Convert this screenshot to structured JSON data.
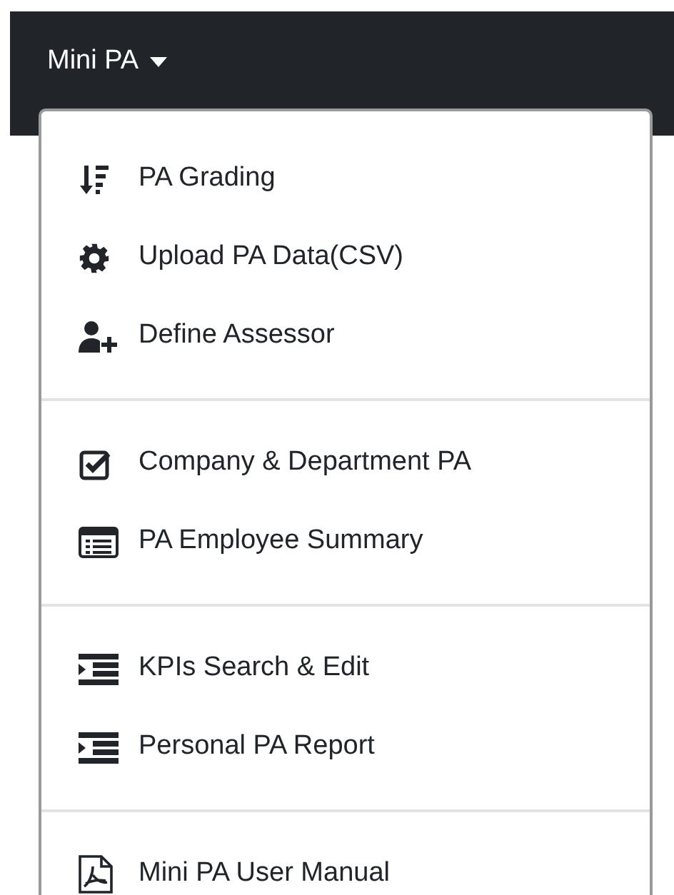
{
  "navbar": {
    "menu_title": "Mini PA"
  },
  "dropdown": {
    "groups": [
      {
        "items": [
          {
            "label": "PA Grading",
            "kind": "sort"
          },
          {
            "label": "Upload PA Data(CSV)",
            "kind": "gear"
          },
          {
            "label": "Define Assessor",
            "kind": "user-plus"
          }
        ]
      },
      {
        "items": [
          {
            "label": "Company & Department PA",
            "kind": "check"
          },
          {
            "label": "PA Employee Summary",
            "kind": "list-card"
          }
        ]
      },
      {
        "items": [
          {
            "label": "KPIs Search & Edit",
            "kind": "indent"
          },
          {
            "label": "Personal PA Report",
            "kind": "indent"
          }
        ]
      },
      {
        "items": [
          {
            "label": "Mini PA User Manual",
            "kind": "pdf"
          }
        ]
      }
    ]
  }
}
